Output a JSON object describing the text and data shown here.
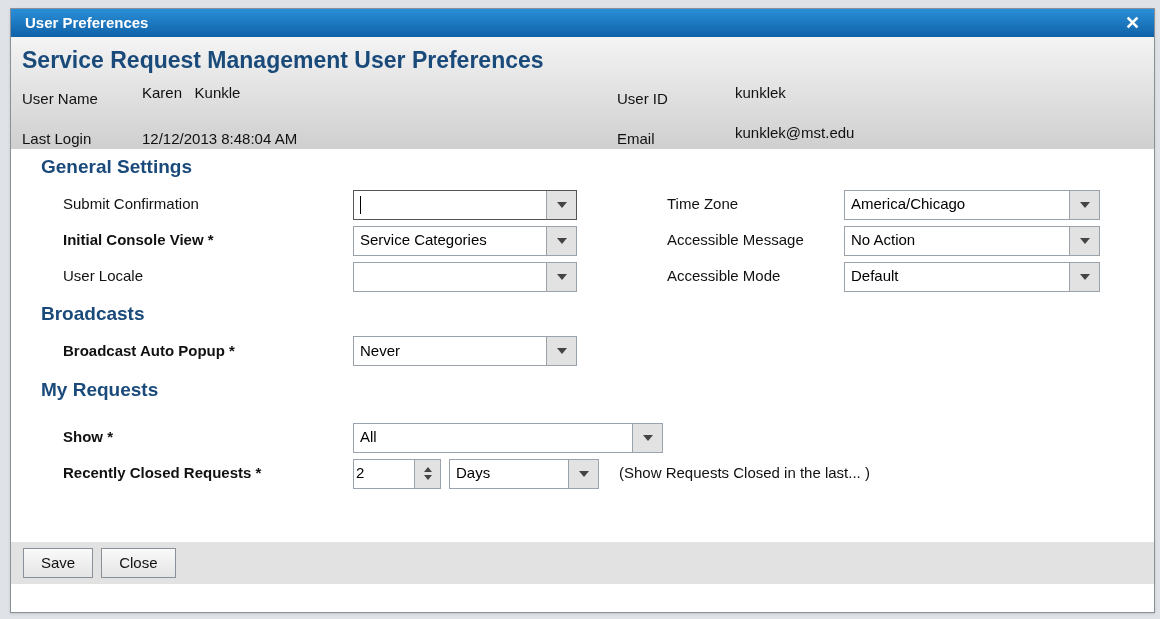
{
  "window": {
    "title": "User Preferences",
    "close": "✕"
  },
  "header": {
    "title": "Service Request Management User Preferences",
    "fields": [
      {
        "label": "User Name",
        "value": "Karen   Kunkle"
      },
      {
        "label": "User ID",
        "value": "kunklek"
      },
      {
        "label": "Last Login",
        "value": "12/12/2013 8:48:04 AM"
      },
      {
        "label": "Email",
        "value": "kunklek@mst.edu"
      }
    ]
  },
  "sections": [
    {
      "title": "General Settings",
      "rows": [
        [
          {
            "label": "Submit Confirmation",
            "required": false,
            "focused": true
          },
          {
            "label": "Time Zone",
            "required": false,
            "value": "America/Chicago",
            "focused": false
          }
        ],
        [
          {
            "label": "Initial Console View *",
            "required": true,
            "value": "Service Categories",
            "focused": false
          },
          {
            "label": "Accessible Message",
            "required": false,
            "value": "No Action",
            "focused": false
          }
        ],
        [
          {
            "label": "User Locale",
            "required": false,
            "focused": false
          },
          {
            "label": "Accessible Mode",
            "required": false,
            "value": "Default",
            "focused": false
          }
        ]
      ]
    },
    {
      "title": "Broadcasts",
      "rows": [
        [
          {
            "label": "Broadcast Auto Popup *",
            "required": true,
            "value": "Never",
            "focused": false
          }
        ]
      ]
    },
    {
      "title": "My Requests",
      "rows": [
        [
          {
            "label": "Show *",
            "required": true,
            "value": "All",
            "focused": false,
            "kind": "wide"
          }
        ],
        [
          {
            "label": "Recently Closed Requests *",
            "required": true,
            "kind": "period",
            "number": "2",
            "unit": "Days",
            "hint": "(Show Requests Closed in the last... )"
          }
        ]
      ]
    }
  ],
  "buttons": [
    "Save",
    "Close"
  ]
}
